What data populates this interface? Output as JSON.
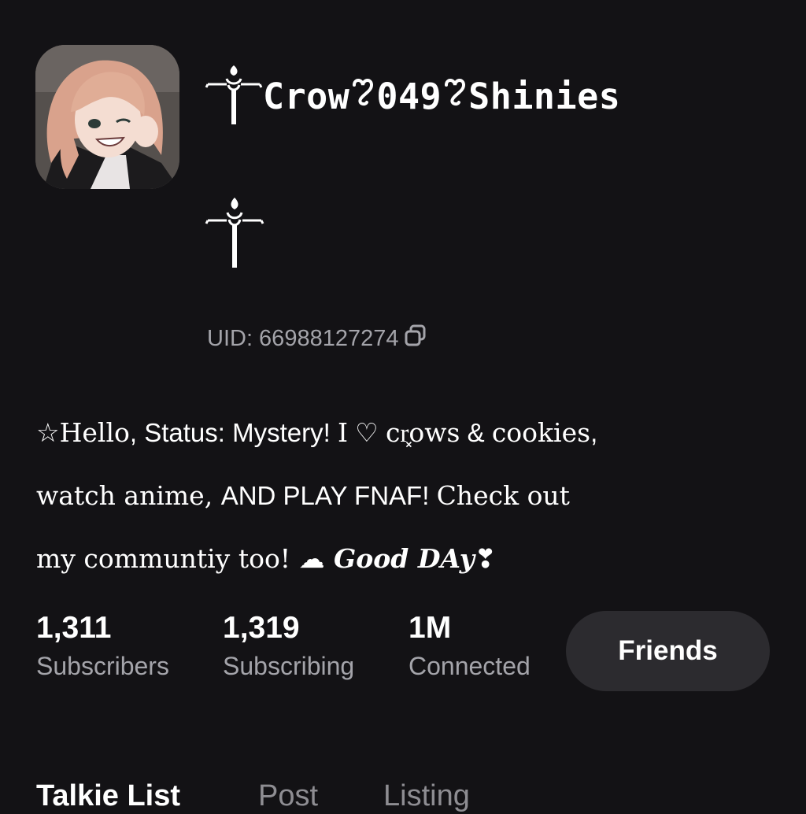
{
  "profile": {
    "avatar_icon": "profile-avatar-anime-character",
    "name_prefix_symbol": "scepter-emblem",
    "name_parts": [
      "Crow",
      "049",
      "Shinies"
    ],
    "name_separator_symbol": "cursive-heart",
    "second_line_symbol": "scepter-emblem",
    "uid_label": "UID: 66988127274",
    "copy_icon": "copy-icon"
  },
  "bio": {
    "line1": {
      "star": "☆",
      "hello": "Hello",
      "status": ", Status: Mystery! ",
      "i": "I",
      "heart": " ♡ ",
      "crows": "cr͓ows",
      "and": " & ",
      "cookies": "cookies",
      "comma": ","
    },
    "line2": {
      "watch": "watch anime, ",
      "and_play": "AND PLAY FNAF! ",
      "check": "Check out"
    },
    "line3": {
      "community": "my communtiy too! ",
      "cloud": "☁",
      "good_day": " Good DAy",
      "end_heart": "❣"
    }
  },
  "stats": [
    {
      "value": "1,311",
      "label": "Subscribers"
    },
    {
      "value": "1,319",
      "label": "Subscribing"
    },
    {
      "value": "1M",
      "label": "Connected"
    }
  ],
  "friends_button": {
    "label": "Friends"
  },
  "tabs": [
    {
      "label": "Talkie List",
      "active": true
    },
    {
      "label": "Post",
      "active": false
    },
    {
      "label": "Listing",
      "active": false
    }
  ],
  "colors": {
    "background": "#131215",
    "button_bg": "#2c2b2f",
    "muted_text": "#a4a4aa",
    "inactive_tab": "#8e8d92"
  }
}
